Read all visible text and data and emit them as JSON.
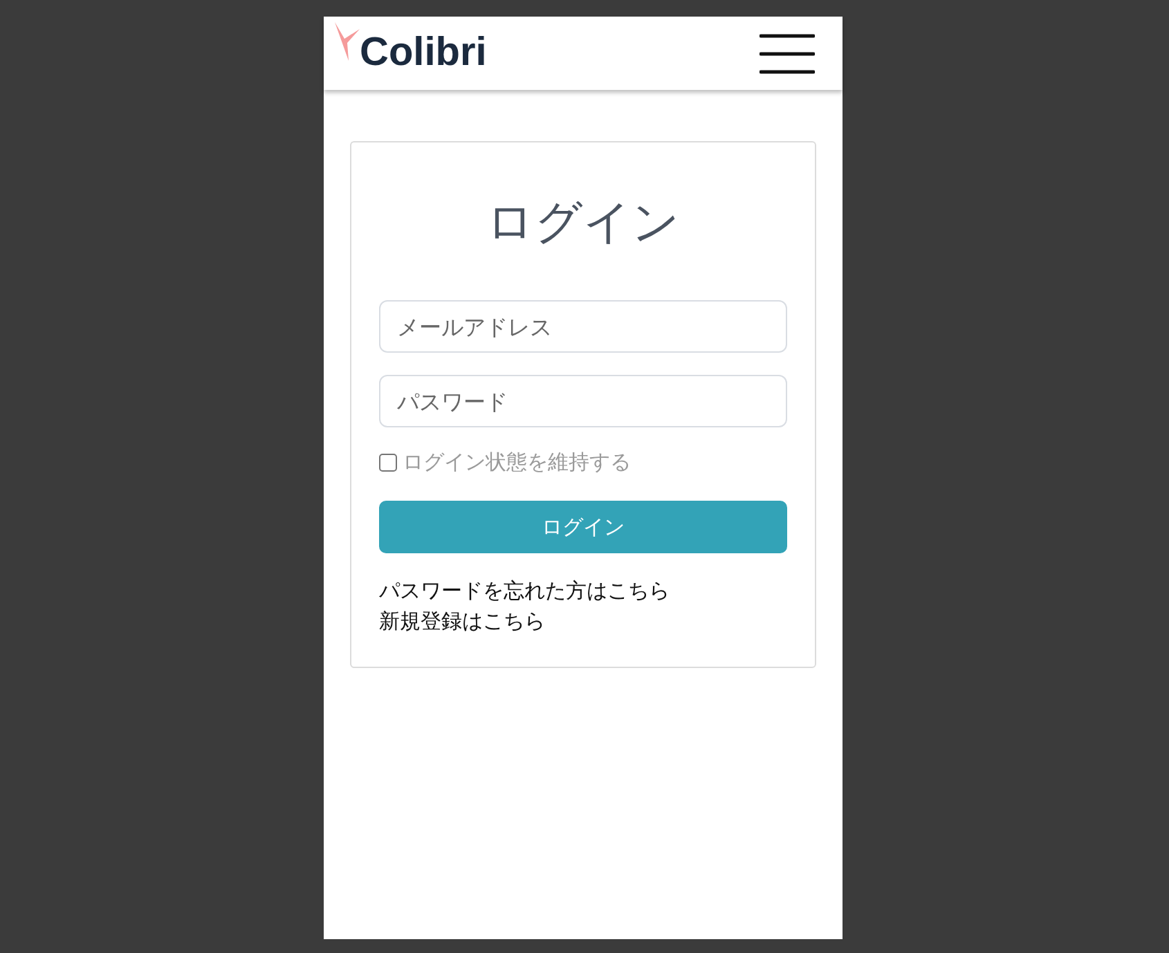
{
  "header": {
    "logo": "Colibri"
  },
  "login": {
    "title": "ログイン",
    "fields": [
      {
        "placeholder": "メールアドレス"
      },
      {
        "placeholder": "パスワード"
      }
    ],
    "remember": {
      "label": "ログイン状態を維持する",
      "checked": false
    },
    "button": "ログイン",
    "links": [
      "パスワードを忘れた方はこちら",
      "新規登録はこちら"
    ]
  }
}
